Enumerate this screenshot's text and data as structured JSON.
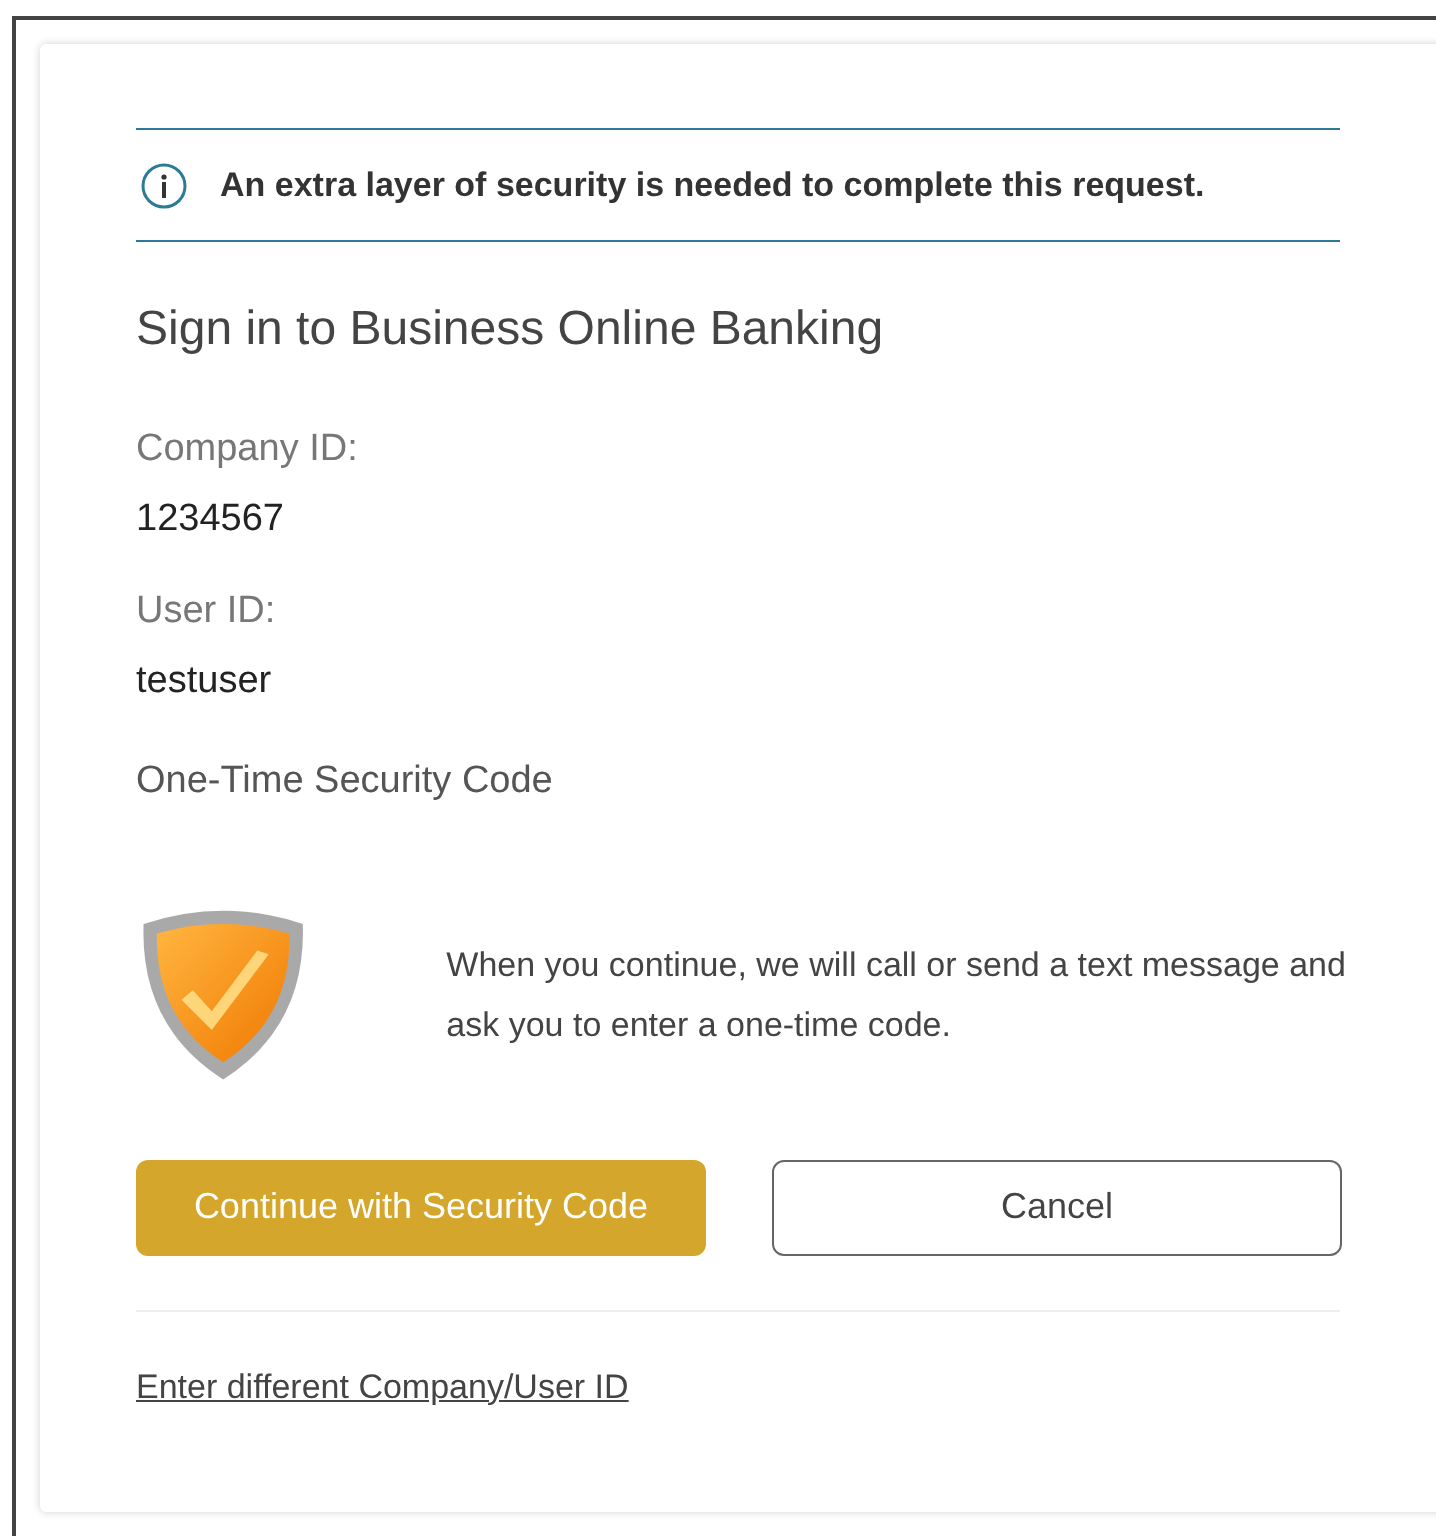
{
  "alert": {
    "text": "An extra layer of security is needed to complete this request."
  },
  "title": "Sign in to Business Online Banking",
  "fields": [
    {
      "label": "Company ID:",
      "value": "1234567"
    },
    {
      "label": "User ID:",
      "value": "testuser"
    }
  ],
  "section": "One-Time Security Code",
  "notice": "When you continue, we will call or send a text message and ask you to enter a one-time code.",
  "buttons": [
    {
      "label": "Continue with Security Code",
      "kind": "primary"
    },
    {
      "label": "Cancel",
      "kind": "secondary"
    }
  ],
  "link": "Enter different Company/User ID"
}
